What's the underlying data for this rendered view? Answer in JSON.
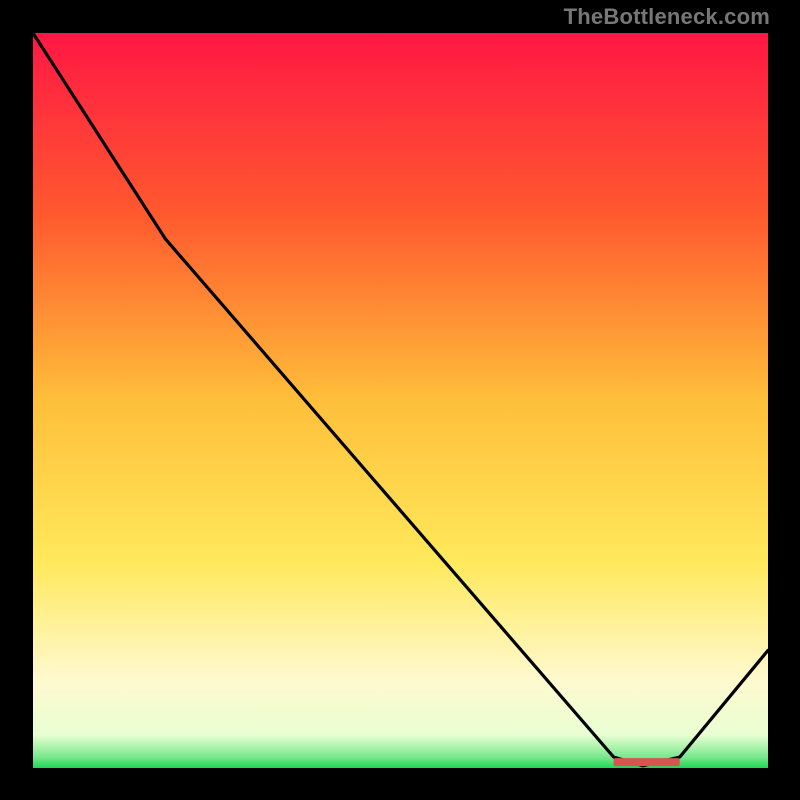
{
  "watermark": "TheBottleneck.com",
  "colors": {
    "bg": "#000000",
    "grad_top": "#ff1744",
    "grad_mid1": "#ff7a2e",
    "grad_mid2": "#ffd93d",
    "grad_low1": "#fff59d",
    "grad_low2": "#f4ffd6",
    "grad_bottom": "#1fd655",
    "line": "#000000",
    "marker": "#d9534f",
    "watermark": "#777777"
  },
  "chart_data": {
    "type": "line",
    "title": "",
    "xlabel": "",
    "ylabel": "",
    "xlim": [
      0,
      1
    ],
    "ylim": [
      0,
      1
    ],
    "x": [
      0.0,
      0.18,
      0.79,
      0.83,
      0.88,
      1.0
    ],
    "values": [
      1.0,
      0.72,
      0.015,
      0.003,
      0.015,
      0.16
    ],
    "optimal_range_x": [
      0.79,
      0.88
    ],
    "optimal_y": 0.008,
    "gradient_stops": [
      {
        "pos": 0.0,
        "color": "#ff1744"
      },
      {
        "pos": 0.25,
        "color": "#ff5a2e"
      },
      {
        "pos": 0.5,
        "color": "#ffbf3a"
      },
      {
        "pos": 0.72,
        "color": "#ffe95c"
      },
      {
        "pos": 0.88,
        "color": "#fff9cf"
      },
      {
        "pos": 0.955,
        "color": "#e9ffd2"
      },
      {
        "pos": 0.985,
        "color": "#7be88e"
      },
      {
        "pos": 1.0,
        "color": "#1fd655"
      }
    ]
  }
}
